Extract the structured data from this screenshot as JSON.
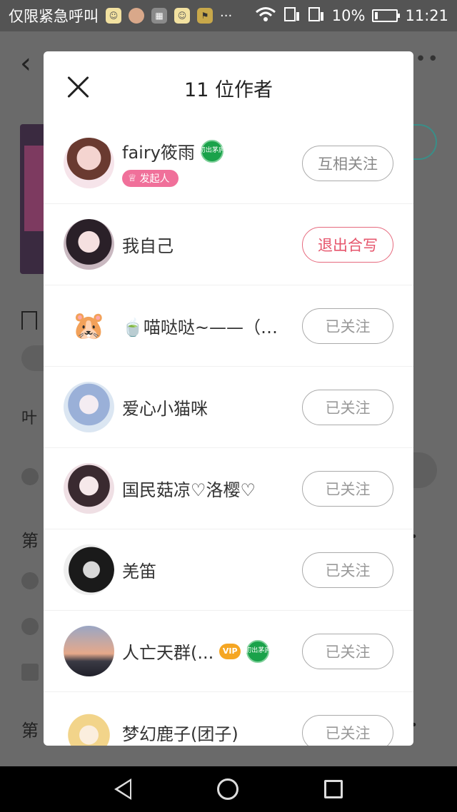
{
  "status_bar": {
    "carrier": "仅限紧急呼叫",
    "battery": "10%",
    "time": "11:21"
  },
  "background": {
    "texts": [
      "叶",
      "第",
      "第"
    ]
  },
  "modal": {
    "title": "11 位作者",
    "founder_label": "发起人",
    "authors": [
      {
        "name": "fairy筱雨",
        "button": "互相关注",
        "button_type": "mutual",
        "founder": true,
        "badge": "初出茅庐"
      },
      {
        "name": "我自己",
        "button": "退出合写",
        "button_type": "exit"
      },
      {
        "name": "🍵喵哒哒~——（回...",
        "button": "已关注",
        "button_type": "followed"
      },
      {
        "name": "爱心小猫咪",
        "button": "已关注",
        "button_type": "followed"
      },
      {
        "name": "国民菇凉♡洛樱♡",
        "button": "已关注",
        "button_type": "followed"
      },
      {
        "name": "羌笛",
        "button": "已关注",
        "button_type": "followed"
      },
      {
        "name": "人亡天群(...",
        "button": "已关注",
        "button_type": "followed",
        "vip": "VIP",
        "badge": "初出茅庐"
      },
      {
        "name": "梦幻鹿子(团子)",
        "button": "已关注",
        "button_type": "followed"
      }
    ]
  }
}
